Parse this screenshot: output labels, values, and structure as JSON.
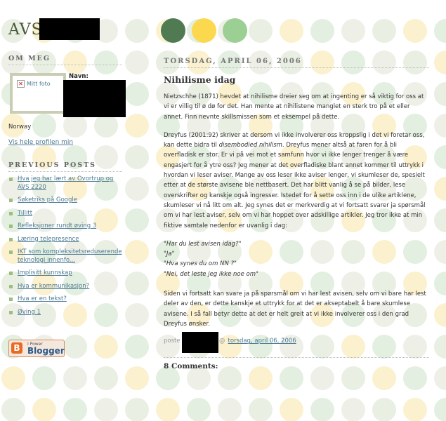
{
  "blog": {
    "title": "AVS"
  },
  "palette": {
    "circle_dark": "#4f7a52",
    "circle_yellow": "#fcd84e",
    "circle_green": "#9ccf94",
    "dot_faint": "#e8eedf",
    "link": "#4b7a93"
  },
  "sidebar": {
    "about_heading": "Om meg",
    "photo_alt": "Mitt foto",
    "name_label": "Navn:",
    "country": "Norway",
    "profile_link": "Vis hele profilen min",
    "previous_heading": "Previous Posts",
    "previous_posts": [
      "Hva jeg har lært av Ovortrup og AVS 2220",
      "Søketriks på Google",
      "Tillitt",
      "Refleksjoner rundt øving 3",
      "Læring telepresence",
      "IKT som kompleksitetsreduserende teknologi innenfo...",
      "Implisitt kunnskap",
      "Hva er kommunikasjon?",
      "Hva er en tekst?",
      "Øving 1"
    ],
    "badge": {
      "small": "I Power",
      "big": "Blogger",
      "icon": "B"
    }
  },
  "post": {
    "date": "Torsdag, April 06, 2006",
    "title": "Nihilisme idag",
    "p1": "Nietzschhe (1871) hevdet at nihilisme dreier seg om at ingenting er så viktig for oss at vi er villig til ø dø for det. Han mente at nihilistene manglet en sterk tro på et eller annet. Finn nevnte skillsmissen som et eksempel på dette.",
    "p2_before": "Dreyfus (2001:92) skriver at dersom vi ikke involverer oss kroppslig i det vi foretar oss, kan dette bidra til ",
    "p2_italic": "disembodied nihilism",
    "p2_after": ". Dreyfus mener altså at faren for å bli overfladisk er stor. Er vi på vei mot et samfunn hvor vi ikke lenger trenger å være engasjert for å ytre oss? Jeg mener at det overfladiske blant annet kommer til uttrykk i hvordan vi leser aviser. Mange av oss leser ikke aviser lenger, vi skumleser de, spesielt etter at de største avisene ble nettbasert. Det har blitt vanlig å se på bilder, lese overskrifter og kanskje også ingresser. Istedet for å sette oss inn i de ulike artiklene, skumleser vi nå litt om alt. Jeg synes det er merkverdig at vi fortsatt svarer ja spørsmål om vi har lest aviser, selv om vi har hoppet over adskillige artikler. Jeg tror ikke at min fiktive samtale nedenfor er uvanlig i dag:",
    "dialogue": [
      "\"Har du lest avisen idag?\"",
      "\"Ja\"",
      "\"Hva synes du om NN ?\"",
      "\"Nei, det leste jeg ikke noe om\""
    ],
    "p3": "Siden vi fortsatt kan svare ja på spørsmål om vi har lest avisen, selv om vi bare har lest deler av den, er dette kanskje et uttrykk for at det er akseptabelt å bare skumlese avisene. I så fall betyr dette at det er helt greit at vi ikke involverer oss i den grad Dreyfus ønsker.",
    "posted_by": "poste",
    "posted_at": "@",
    "posted_time": "torsdag, april 06, 2006",
    "comments": "8 Comments:"
  }
}
